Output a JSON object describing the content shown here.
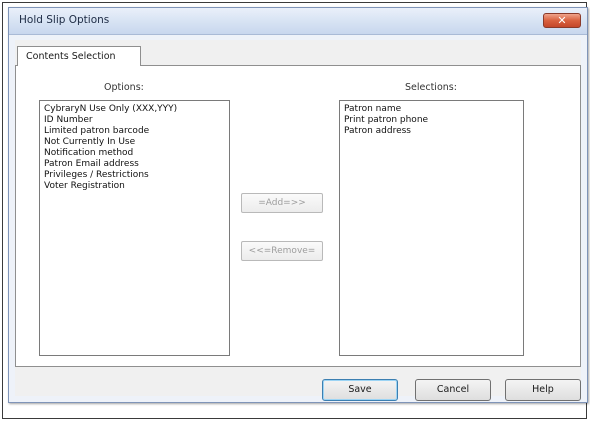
{
  "dialog": {
    "title": "Hold Slip Options",
    "close_glyph": "✕"
  },
  "tabs": [
    {
      "label": "Contents Selection"
    }
  ],
  "options": {
    "label": "Options:",
    "items": [
      "CybraryN Use Only (XXX,YYY)",
      "ID Number",
      "Limited patron barcode",
      "Not Currently In Use",
      "Notification method",
      "Patron Email address",
      "Privileges / Restrictions",
      "Voter Registration"
    ]
  },
  "selections": {
    "label": "Selections:",
    "items": [
      "Patron name",
      "Print patron phone",
      "Patron address"
    ]
  },
  "actions": {
    "add_label": "=Add=>>",
    "remove_label": "<<=Remove="
  },
  "footer": {
    "save_label": "Save",
    "cancel_label": "Cancel",
    "help_label": "Help"
  }
}
